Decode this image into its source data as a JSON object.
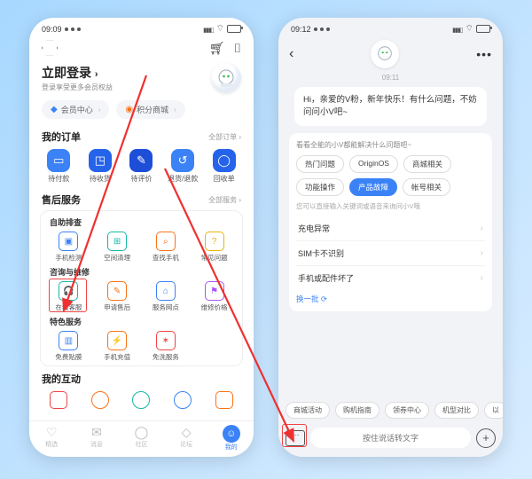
{
  "left": {
    "status_time": "09:09",
    "login_title": "立即登录",
    "login_sub": "登录享受更多会员权益",
    "pill_member": "会员中心",
    "pill_points": "积分商城",
    "orders_title": "我的订单",
    "orders_more": "全部订单 ›",
    "orders": [
      "待付款",
      "待收货",
      "待评价",
      "退货/退款",
      "回收单"
    ],
    "aftersale_title": "售后服务",
    "aftersale_more": "全部服务 ›",
    "group_self": "自助排查",
    "self_items": [
      "手机检测",
      "空间清理",
      "查找手机",
      "常见问题"
    ],
    "group_consult": "咨询与维修",
    "consult_items": [
      "在线客服",
      "申请售后",
      "服务网点",
      "维修价格"
    ],
    "group_special": "特色服务",
    "special_items": [
      "免费贴膜",
      "手机充值",
      "免洗服务"
    ],
    "interact_title": "我的互动",
    "nav": [
      "精选",
      "消息",
      "社区",
      "论坛",
      "我的"
    ]
  },
  "right": {
    "status_time": "09:12",
    "chat_time": "09:11",
    "bubble": "Hi，亲爱的V粉，新年快乐！有什么问题，不妨问问小V吧~",
    "help_hint": "看看全能的小V都能解决什么问题吧~",
    "chips": [
      "热门问题",
      "OriginOS",
      "商城相关",
      "功能操作",
      "产品故障",
      "帐号相关"
    ],
    "active_chip_index": 4,
    "kw_hint": "您可以直接输入关键词或语音来询问小V哦",
    "faults": [
      "充电异常",
      "SIM卡不识别",
      "手机或配件坏了"
    ],
    "refresh": "换一批",
    "quick": [
      "商城活动",
      "购机指南",
      "领券中心",
      "机型对比",
      "以"
    ],
    "voice_placeholder": "按住说话转文字"
  }
}
